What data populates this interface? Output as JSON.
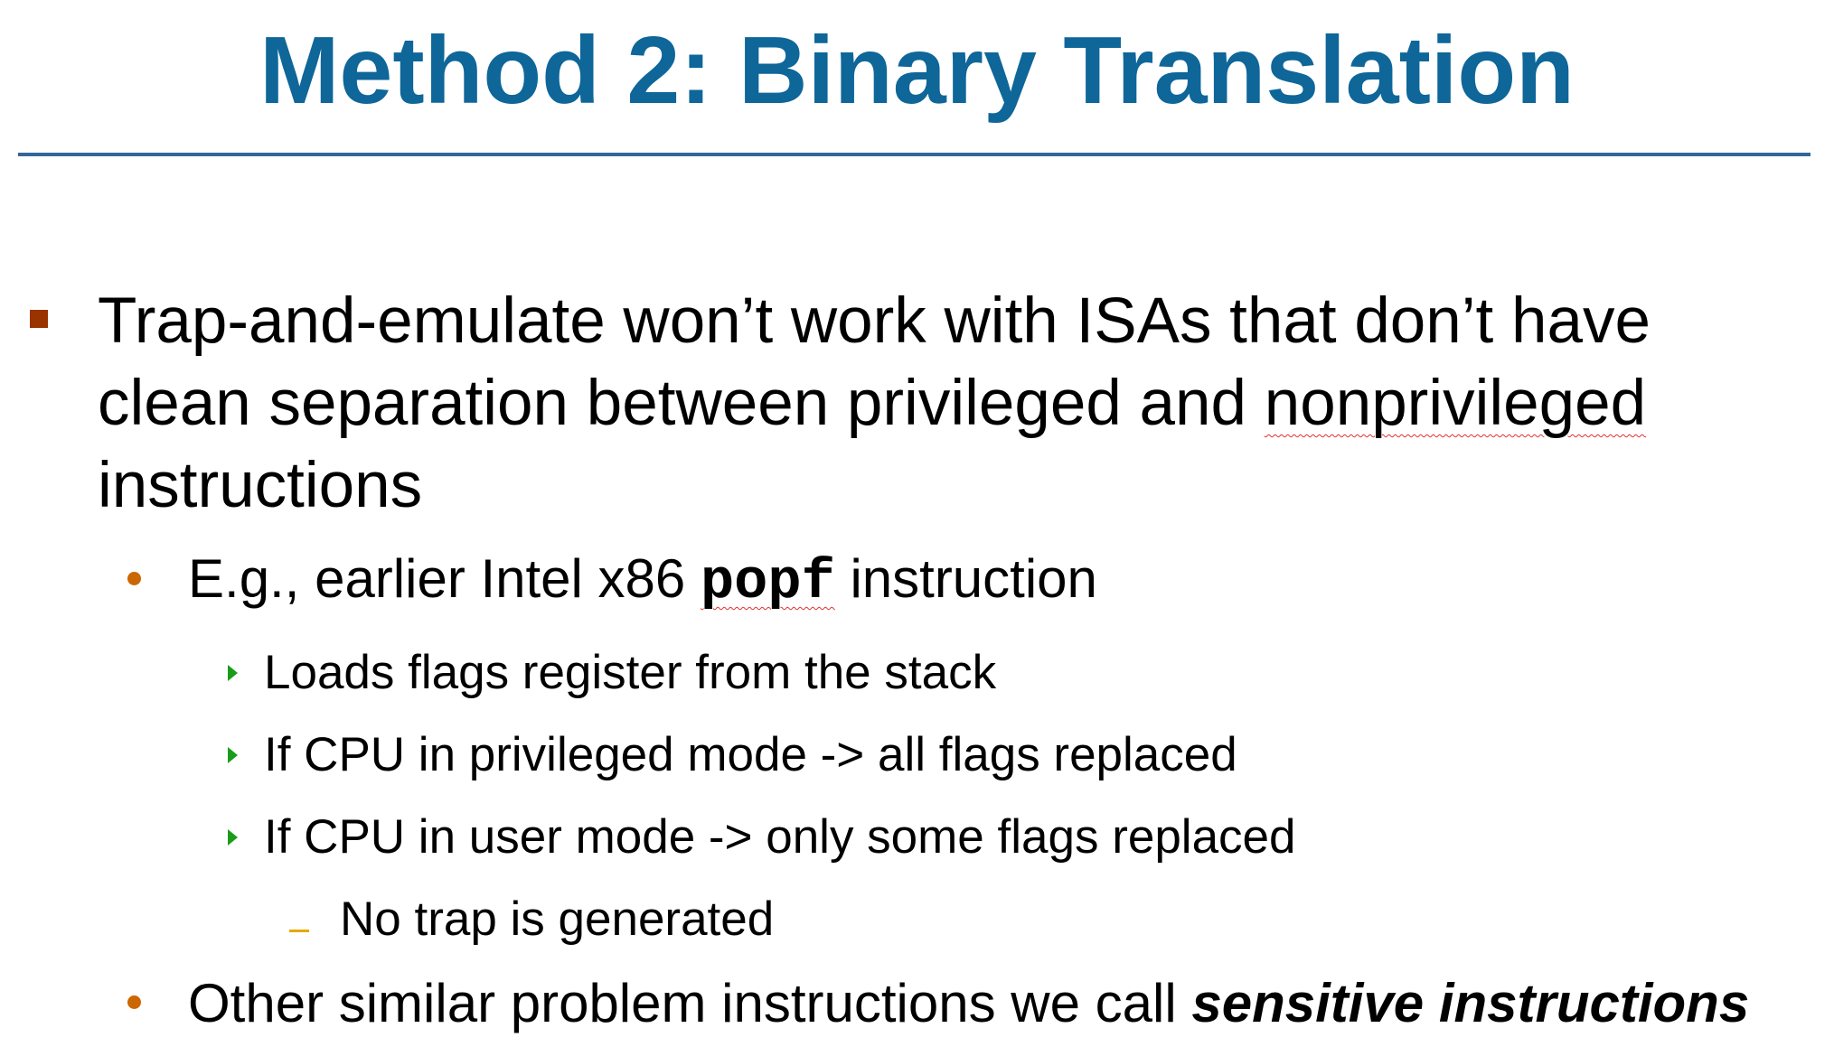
{
  "title": "Method 2: Binary Translation",
  "bullets": {
    "main": {
      "line1": "Trap-and-emulate won’t work with ISAs that don’t have",
      "line2_pre": "clean separation between privileged and ",
      "line2_flagged": "nonprivileged",
      "line3": "instructions"
    },
    "example": {
      "pre": "E.g., earlier Intel x86 ",
      "code": "popf",
      "post": " instruction"
    },
    "details": [
      "Loads flags register from the stack",
      "If CPU in privileged mode -> all flags replaced",
      "If CPU in user mode -> only some flags replaced"
    ],
    "sub_detail": "No trap is generated",
    "other": {
      "pre": "Other similar problem instructions we call ",
      "emphasis": "sensitive instructions"
    }
  },
  "colors": {
    "title": "#0e6699",
    "rule": "#336699",
    "level1_marker": "#993300",
    "level2_marker": "#cc6600",
    "level3_marker": "#1a9c1a",
    "level4_marker": "#e6a800"
  }
}
